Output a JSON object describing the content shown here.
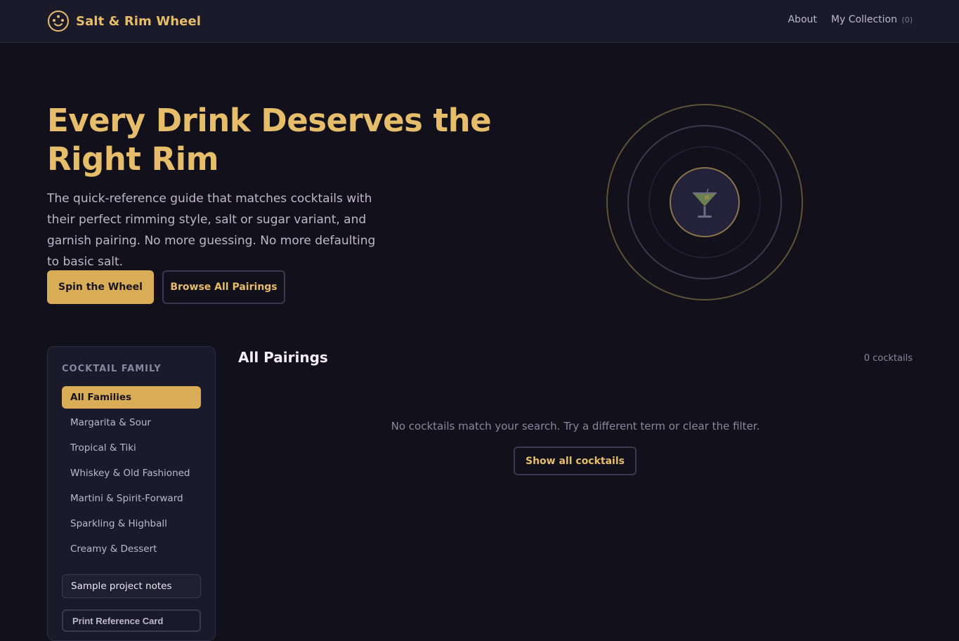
{
  "header": {
    "brand_name": "Salt & Rim Wheel",
    "brand_icon": "wheel-logo-icon",
    "nav": {
      "about_label": "About",
      "collection_label": "My Collection",
      "collection_count": "(0)"
    }
  },
  "hero": {
    "title": "Every Drink Deserves the Right Rim",
    "subtitle": "The quick-reference guide that matches cocktails with their perfect rimming style, salt or sugar variant, and garnish pairing. No more guessing. No more defaulting to basic salt.",
    "primary_button": "Spin the Wheel",
    "secondary_button": "Browse All Pairings",
    "wheel_icon": "martini-glass-icon"
  },
  "sidebar": {
    "heading": "COCKTAIL FAMILY",
    "items": [
      {
        "label": "All Families",
        "active": true
      },
      {
        "label": "Margarita & Sour",
        "active": false
      },
      {
        "label": "Tropical & Tiki",
        "active": false
      },
      {
        "label": "Whiskey & Old Fashioned",
        "active": false
      },
      {
        "label": "Martini & Spirit-Forward",
        "active": false
      },
      {
        "label": "Sparkling & Highball",
        "active": false
      },
      {
        "label": "Creamy & Dessert",
        "active": false
      }
    ],
    "notes_label": "Sample project notes",
    "print_label": "Print Reference Card"
  },
  "main": {
    "title": "All Pairings",
    "count": "0 cocktails",
    "empty_message": "No cocktails match your search. Try a different term or clear the filter.",
    "show_all_button": "Show all cocktails"
  },
  "colors": {
    "background": "#12111b",
    "header_bg": "#1b1a2a",
    "accent_gold": "#e6bd6a",
    "button_gold": "#d9ad57",
    "muted_text": "#8a86a0"
  }
}
